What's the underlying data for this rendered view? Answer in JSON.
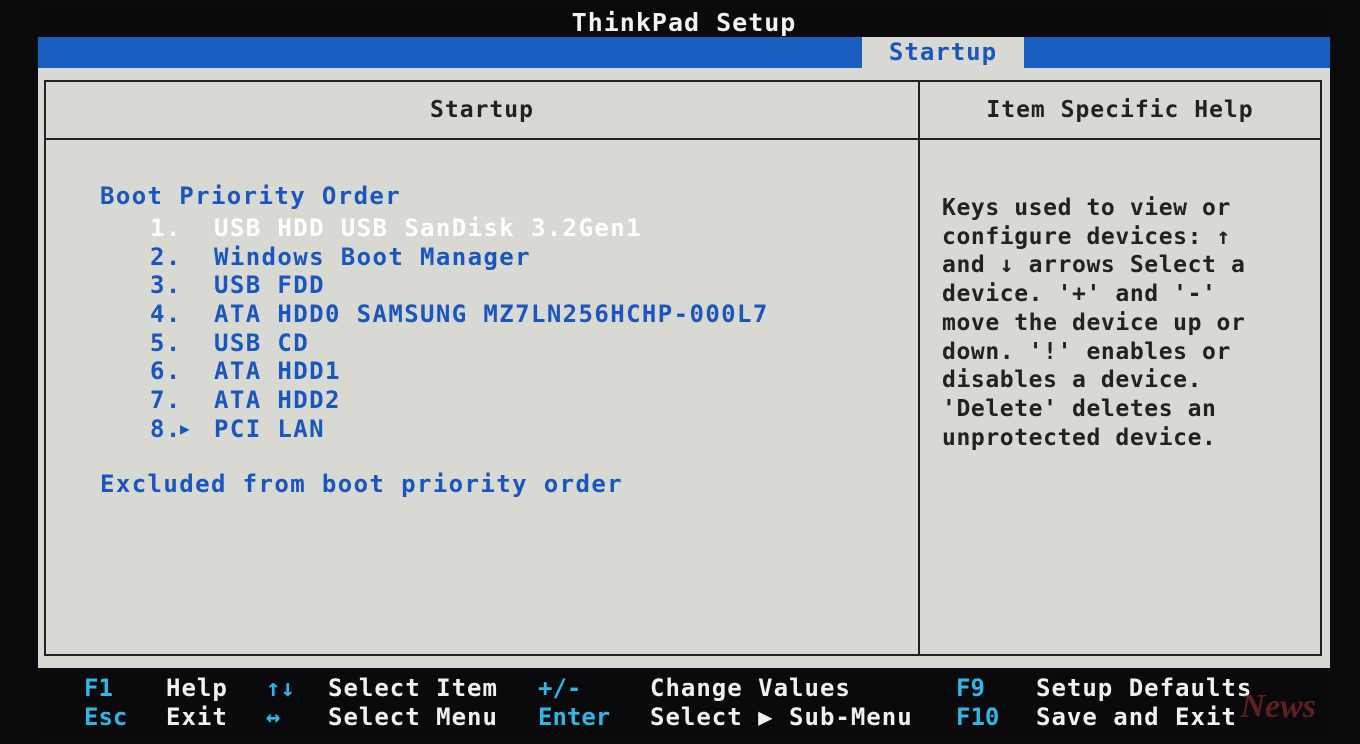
{
  "window": {
    "title": "ThinkPad Setup"
  },
  "menu": {
    "active_tab": "Startup"
  },
  "panel": {
    "left_header": "Startup",
    "right_header": "Item Specific Help"
  },
  "boot": {
    "section_title": "Boot Priority Order",
    "items": [
      {
        "num": "1.",
        "label": "USB HDD USB SanDisk 3.2Gen1"
      },
      {
        "num": "2.",
        "label": "Windows Boot Manager"
      },
      {
        "num": "3.",
        "label": "USB FDD"
      },
      {
        "num": "4.",
        "label": "ATA HDD0 SAMSUNG MZ7LN256HCHP-000L7"
      },
      {
        "num": "5.",
        "label": "USB CD"
      },
      {
        "num": "6.",
        "label": "ATA HDD1"
      },
      {
        "num": "7.",
        "label": "ATA HDD2"
      },
      {
        "num": "8.",
        "label": "PCI LAN"
      }
    ],
    "selected_index": 0,
    "arrow_marker": "▶",
    "excluded_title": "Excluded from boot priority order"
  },
  "help": {
    "text": "Keys used to view or\nconfigure devices: ↑\nand ↓ arrows Select a\ndevice. '+' and '-'\nmove the device up or\ndown. '!' enables or\ndisables a device.\n'Delete' deletes an\nunprotected device."
  },
  "footer": {
    "row1": [
      {
        "key": "F1",
        "desc": "Help"
      },
      {
        "key": "↑↓",
        "desc": "Select Item"
      },
      {
        "key": "+/-",
        "desc": "Change Values"
      },
      {
        "key": "F9",
        "desc": "Setup Defaults"
      }
    ],
    "row2": [
      {
        "key": "Esc",
        "desc": "Exit"
      },
      {
        "key": "↔",
        "desc": "Select Menu"
      },
      {
        "key": "Enter",
        "desc": "Select ▶ Sub-Menu"
      },
      {
        "key": "F10",
        "desc": "Save and Exit"
      }
    ]
  },
  "watermark": {
    "text": "News"
  },
  "colors": {
    "bios_blue": "#1a5fc0",
    "panel_gray": "#d9d9d3",
    "footer_black": "#0a0a0c",
    "key_cyan": "#2fb6e6",
    "selected_white": "#ffffff"
  }
}
